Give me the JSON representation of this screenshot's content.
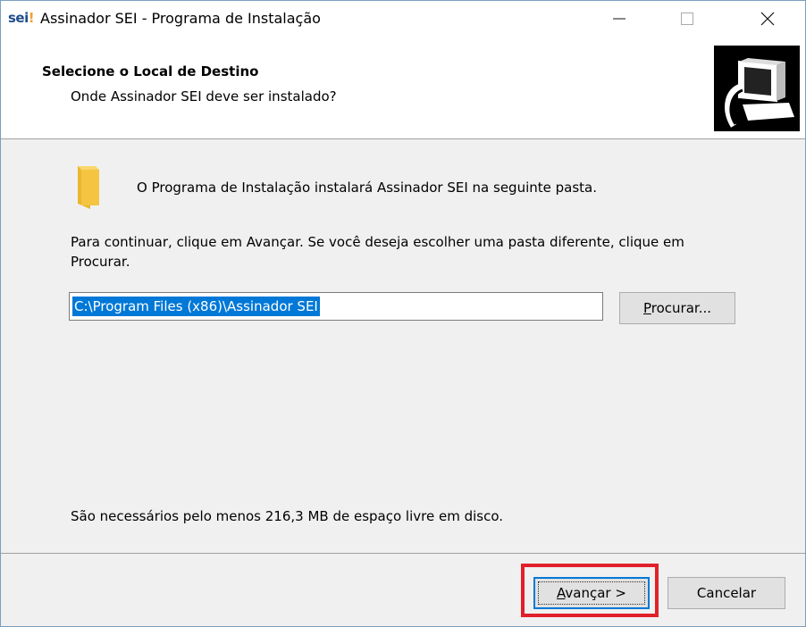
{
  "window": {
    "logo": "sei",
    "logo_dot": "!",
    "title": "Assinador SEI - Programa de Instalação",
    "controls": {
      "minimize": "—",
      "maximize": "☐",
      "close": "✕"
    }
  },
  "header": {
    "title": "Selecione o Local de Destino",
    "subtitle": "Onde Assinador SEI deve ser instalado?"
  },
  "content": {
    "intro": "O Programa de Instalação instalará Assinador SEI na seguinte pasta.",
    "instructions": "Para continuar, clique em Avançar. Se você deseja escolher uma pasta diferente, clique em Procurar.",
    "path_value": "C:\\Program Files (x86)\\Assinador SEI",
    "browse_label_prefix": "",
    "browse_label_ul": "P",
    "browse_label_rest": "rocurar...",
    "space_required": "São necessários pelo menos 216,3 MB de espaço livre em disco."
  },
  "footer": {
    "next_label_ul": "A",
    "next_label_rest": "vançar >",
    "cancel_label": "Cancelar"
  },
  "colors": {
    "highlight": "#e0202a",
    "selection": "#0078d7",
    "folder": "#f5c542"
  }
}
